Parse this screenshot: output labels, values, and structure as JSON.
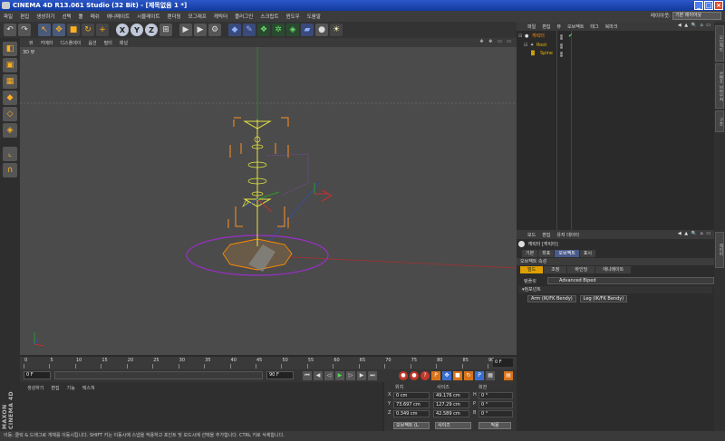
{
  "window": {
    "title": "CINEMA 4D R13.061 Studio (32 Bit) - [제목없음 1 *]",
    "buttons": [
      "_",
      "□",
      "×"
    ]
  },
  "menubar": {
    "items": [
      "파일",
      "편집",
      "생성하기",
      "선택",
      "툴",
      "메쉬",
      "애니메이트",
      "시뮬레이트",
      "랜더링",
      "모그래프",
      "캐릭터",
      "플러그인",
      "스크립트",
      "윈도우",
      "도움말"
    ],
    "layout_label": "레이아웃:",
    "layout_value": "기본 레이아웃"
  },
  "viewport": {
    "menu": [
      "뷰",
      "카메라",
      "디스플레이",
      "옵션",
      "필터",
      "패널"
    ],
    "label": "3D 뷰",
    "nav_icons": "✥ ✥ ▭ ▭"
  },
  "timeline": {
    "ticks": [
      "0",
      "5",
      "10",
      "15",
      "20",
      "25",
      "30",
      "35",
      "40",
      "45",
      "50",
      "55",
      "60",
      "65",
      "70",
      "75",
      "80",
      "85",
      "90"
    ],
    "current_frame": "0 F"
  },
  "playbar": {
    "start": "0 F",
    "end": "90 F",
    "end2": "90 F"
  },
  "material": {
    "menu": [
      "생성하기",
      "편집",
      "기능",
      "텍스쳐"
    ]
  },
  "maxon": {
    "text": "MAXON CINEMA 4D"
  },
  "coordinates": {
    "headers": [
      "위치",
      "사이즈",
      "회전"
    ],
    "rows": [
      {
        "axis": "X",
        "pos": "0 cm",
        "size": "49.176 cm",
        "rot_axis": "H",
        "rot": "0 °"
      },
      {
        "axis": "Y",
        "pos": "73.697 cm",
        "size": "127.29 cm",
        "rot_axis": "P",
        "rot": "0 °"
      },
      {
        "axis": "Z",
        "pos": "0.349 cm",
        "size": "42.589 cm",
        "rot_axis": "B",
        "rot": "0 °"
      }
    ],
    "mode_dropdown": "오브젝트 (L",
    "size_dropdown": "사이즈",
    "apply_button": "적용"
  },
  "object_manager": {
    "menu": [
      "파일",
      "편집",
      "뷰",
      "오브젝트",
      "태그",
      "북마크"
    ],
    "tree": [
      {
        "name": "캐릭터",
        "indent": 0,
        "selected": true
      },
      {
        "name": "Root",
        "indent": 1,
        "selected": false
      },
      {
        "name": "Spine",
        "indent": 2,
        "selected": false
      }
    ]
  },
  "attribute_manager": {
    "menu": [
      "모드",
      "편집",
      "유저 데이터"
    ],
    "title": "캐릭터 [캐릭터]",
    "tabs": [
      "기본",
      "좌표",
      "오브젝트",
      "표시"
    ],
    "active_tab": "오브젝트",
    "section": "오브젝트 속성",
    "subtabs": [
      "빌드",
      "조정",
      "바인딩",
      "애니메이트"
    ],
    "active_subtab": "빌드",
    "template_label": "템플릿",
    "template_value": "Advanced Biped",
    "components_label": "▾컴포넌트",
    "dd1": "Arm (IK/FK Bendy)",
    "dd2": "Leg (IK/FK Bendy)"
  },
  "right_strip": {
    "tabs": [
      "오브젝트",
      "콘텐츠 브라우저",
      "구조",
      "레이어"
    ]
  },
  "status": {
    "text": "이동: 클릭 & 드래그로 개체를 이동시킵니다. SHIFT 키는 이동시에 스냅을 적용하고 포인트 및 모드시에 선택을 추가합니다. CTRL 키로 삭제합니다."
  },
  "colors": {
    "viewport_bg": "#4b4b4b",
    "accent_orange": "#ffb020",
    "selection_purple": "#9a2fc8"
  }
}
